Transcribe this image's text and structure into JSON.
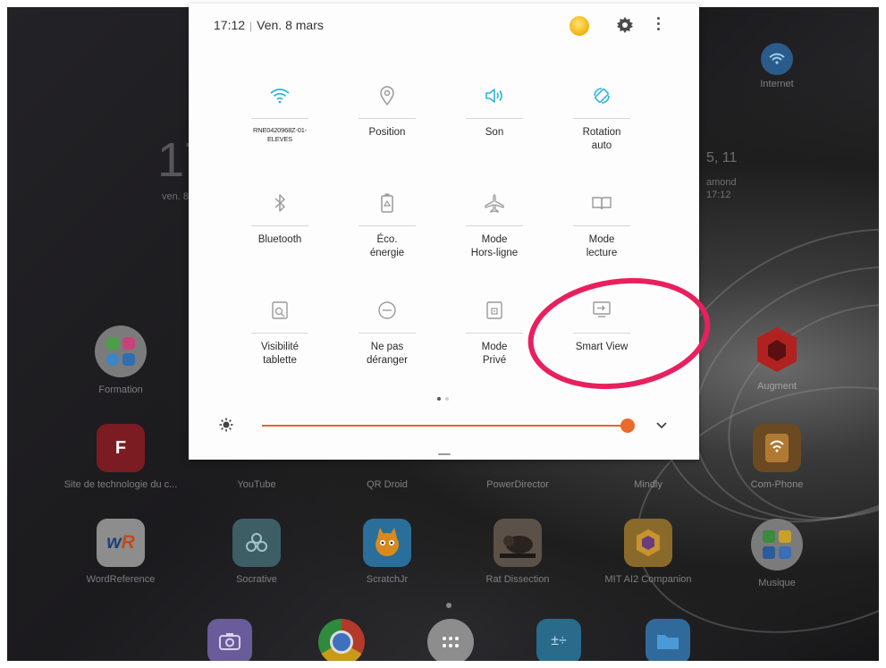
{
  "panel": {
    "time": "17:12",
    "date": "Ven. 8 mars",
    "tiles": [
      {
        "label": "RNE0420968Z-01-\nELEVES",
        "icon": "wifi-icon",
        "active": true
      },
      {
        "label": "Position",
        "icon": "location-icon",
        "active": false
      },
      {
        "label": "Son",
        "icon": "speaker-icon",
        "active": true
      },
      {
        "label": "Rotation\nauto",
        "icon": "rotation-icon",
        "active": true
      },
      {
        "label": "Bluetooth",
        "icon": "bluetooth-icon",
        "active": false
      },
      {
        "label": "Éco.\nénergie",
        "icon": "battery-eco-icon",
        "active": false
      },
      {
        "label": "Mode\nHors-ligne",
        "icon": "airplane-icon",
        "active": false
      },
      {
        "label": "Mode\nlecture",
        "icon": "book-icon",
        "active": false
      },
      {
        "label": "Visibilité\ntablette",
        "icon": "tablet-search-icon",
        "active": false
      },
      {
        "label": "Ne pas\ndéranger",
        "icon": "do-not-disturb-icon",
        "active": false
      },
      {
        "label": "Mode\nPrivé",
        "icon": "private-mode-icon",
        "active": false
      },
      {
        "label": "Smart View",
        "icon": "smart-view-icon",
        "active": false
      }
    ],
    "brightness_level": 0.95,
    "page_count": 2,
    "current_page": 1
  },
  "home": {
    "clock_digits": "17",
    "clock_date": "ven. 8",
    "right_widget_line1": "5, 11",
    "right_widget_line2": "amond",
    "right_widget_line3": "17:12",
    "apps_top_right": "Internet",
    "row1": [
      "Formation",
      "Augment"
    ],
    "row2": [
      "Site de technologie du c...",
      "YouTube",
      "QR Droid",
      "PowerDirector",
      "Mindly",
      "Com-Phone"
    ],
    "row3": [
      "WordReference",
      "Socrative",
      "ScratchJr",
      "Rat Dissection",
      "MIT AI2 Companion",
      "Musique"
    ]
  },
  "colors": {
    "accent": "#2cb5d9",
    "inactive_icon": "#9a9a9a",
    "slider": "#ec6a2c",
    "highlight": "#e8205e"
  }
}
